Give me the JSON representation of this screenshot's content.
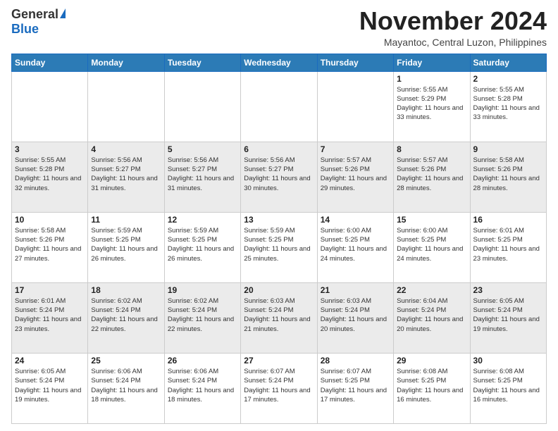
{
  "logo": {
    "general": "General",
    "blue": "Blue"
  },
  "header": {
    "month": "November 2024",
    "location": "Mayantoc, Central Luzon, Philippines"
  },
  "weekdays": [
    "Sunday",
    "Monday",
    "Tuesday",
    "Wednesday",
    "Thursday",
    "Friday",
    "Saturday"
  ],
  "weeks": [
    [
      {
        "day": "",
        "info": ""
      },
      {
        "day": "",
        "info": ""
      },
      {
        "day": "",
        "info": ""
      },
      {
        "day": "",
        "info": ""
      },
      {
        "day": "",
        "info": ""
      },
      {
        "day": "1",
        "info": "Sunrise: 5:55 AM\nSunset: 5:29 PM\nDaylight: 11 hours and 33 minutes."
      },
      {
        "day": "2",
        "info": "Sunrise: 5:55 AM\nSunset: 5:28 PM\nDaylight: 11 hours and 33 minutes."
      }
    ],
    [
      {
        "day": "3",
        "info": "Sunrise: 5:55 AM\nSunset: 5:28 PM\nDaylight: 11 hours and 32 minutes."
      },
      {
        "day": "4",
        "info": "Sunrise: 5:56 AM\nSunset: 5:27 PM\nDaylight: 11 hours and 31 minutes."
      },
      {
        "day": "5",
        "info": "Sunrise: 5:56 AM\nSunset: 5:27 PM\nDaylight: 11 hours and 31 minutes."
      },
      {
        "day": "6",
        "info": "Sunrise: 5:56 AM\nSunset: 5:27 PM\nDaylight: 11 hours and 30 minutes."
      },
      {
        "day": "7",
        "info": "Sunrise: 5:57 AM\nSunset: 5:26 PM\nDaylight: 11 hours and 29 minutes."
      },
      {
        "day": "8",
        "info": "Sunrise: 5:57 AM\nSunset: 5:26 PM\nDaylight: 11 hours and 28 minutes."
      },
      {
        "day": "9",
        "info": "Sunrise: 5:58 AM\nSunset: 5:26 PM\nDaylight: 11 hours and 28 minutes."
      }
    ],
    [
      {
        "day": "10",
        "info": "Sunrise: 5:58 AM\nSunset: 5:26 PM\nDaylight: 11 hours and 27 minutes."
      },
      {
        "day": "11",
        "info": "Sunrise: 5:59 AM\nSunset: 5:25 PM\nDaylight: 11 hours and 26 minutes."
      },
      {
        "day": "12",
        "info": "Sunrise: 5:59 AM\nSunset: 5:25 PM\nDaylight: 11 hours and 26 minutes."
      },
      {
        "day": "13",
        "info": "Sunrise: 5:59 AM\nSunset: 5:25 PM\nDaylight: 11 hours and 25 minutes."
      },
      {
        "day": "14",
        "info": "Sunrise: 6:00 AM\nSunset: 5:25 PM\nDaylight: 11 hours and 24 minutes."
      },
      {
        "day": "15",
        "info": "Sunrise: 6:00 AM\nSunset: 5:25 PM\nDaylight: 11 hours and 24 minutes."
      },
      {
        "day": "16",
        "info": "Sunrise: 6:01 AM\nSunset: 5:25 PM\nDaylight: 11 hours and 23 minutes."
      }
    ],
    [
      {
        "day": "17",
        "info": "Sunrise: 6:01 AM\nSunset: 5:24 PM\nDaylight: 11 hours and 23 minutes."
      },
      {
        "day": "18",
        "info": "Sunrise: 6:02 AM\nSunset: 5:24 PM\nDaylight: 11 hours and 22 minutes."
      },
      {
        "day": "19",
        "info": "Sunrise: 6:02 AM\nSunset: 5:24 PM\nDaylight: 11 hours and 22 minutes."
      },
      {
        "day": "20",
        "info": "Sunrise: 6:03 AM\nSunset: 5:24 PM\nDaylight: 11 hours and 21 minutes."
      },
      {
        "day": "21",
        "info": "Sunrise: 6:03 AM\nSunset: 5:24 PM\nDaylight: 11 hours and 20 minutes."
      },
      {
        "day": "22",
        "info": "Sunrise: 6:04 AM\nSunset: 5:24 PM\nDaylight: 11 hours and 20 minutes."
      },
      {
        "day": "23",
        "info": "Sunrise: 6:05 AM\nSunset: 5:24 PM\nDaylight: 11 hours and 19 minutes."
      }
    ],
    [
      {
        "day": "24",
        "info": "Sunrise: 6:05 AM\nSunset: 5:24 PM\nDaylight: 11 hours and 19 minutes."
      },
      {
        "day": "25",
        "info": "Sunrise: 6:06 AM\nSunset: 5:24 PM\nDaylight: 11 hours and 18 minutes."
      },
      {
        "day": "26",
        "info": "Sunrise: 6:06 AM\nSunset: 5:24 PM\nDaylight: 11 hours and 18 minutes."
      },
      {
        "day": "27",
        "info": "Sunrise: 6:07 AM\nSunset: 5:24 PM\nDaylight: 11 hours and 17 minutes."
      },
      {
        "day": "28",
        "info": "Sunrise: 6:07 AM\nSunset: 5:25 PM\nDaylight: 11 hours and 17 minutes."
      },
      {
        "day": "29",
        "info": "Sunrise: 6:08 AM\nSunset: 5:25 PM\nDaylight: 11 hours and 16 minutes."
      },
      {
        "day": "30",
        "info": "Sunrise: 6:08 AM\nSunset: 5:25 PM\nDaylight: 11 hours and 16 minutes."
      }
    ]
  ]
}
